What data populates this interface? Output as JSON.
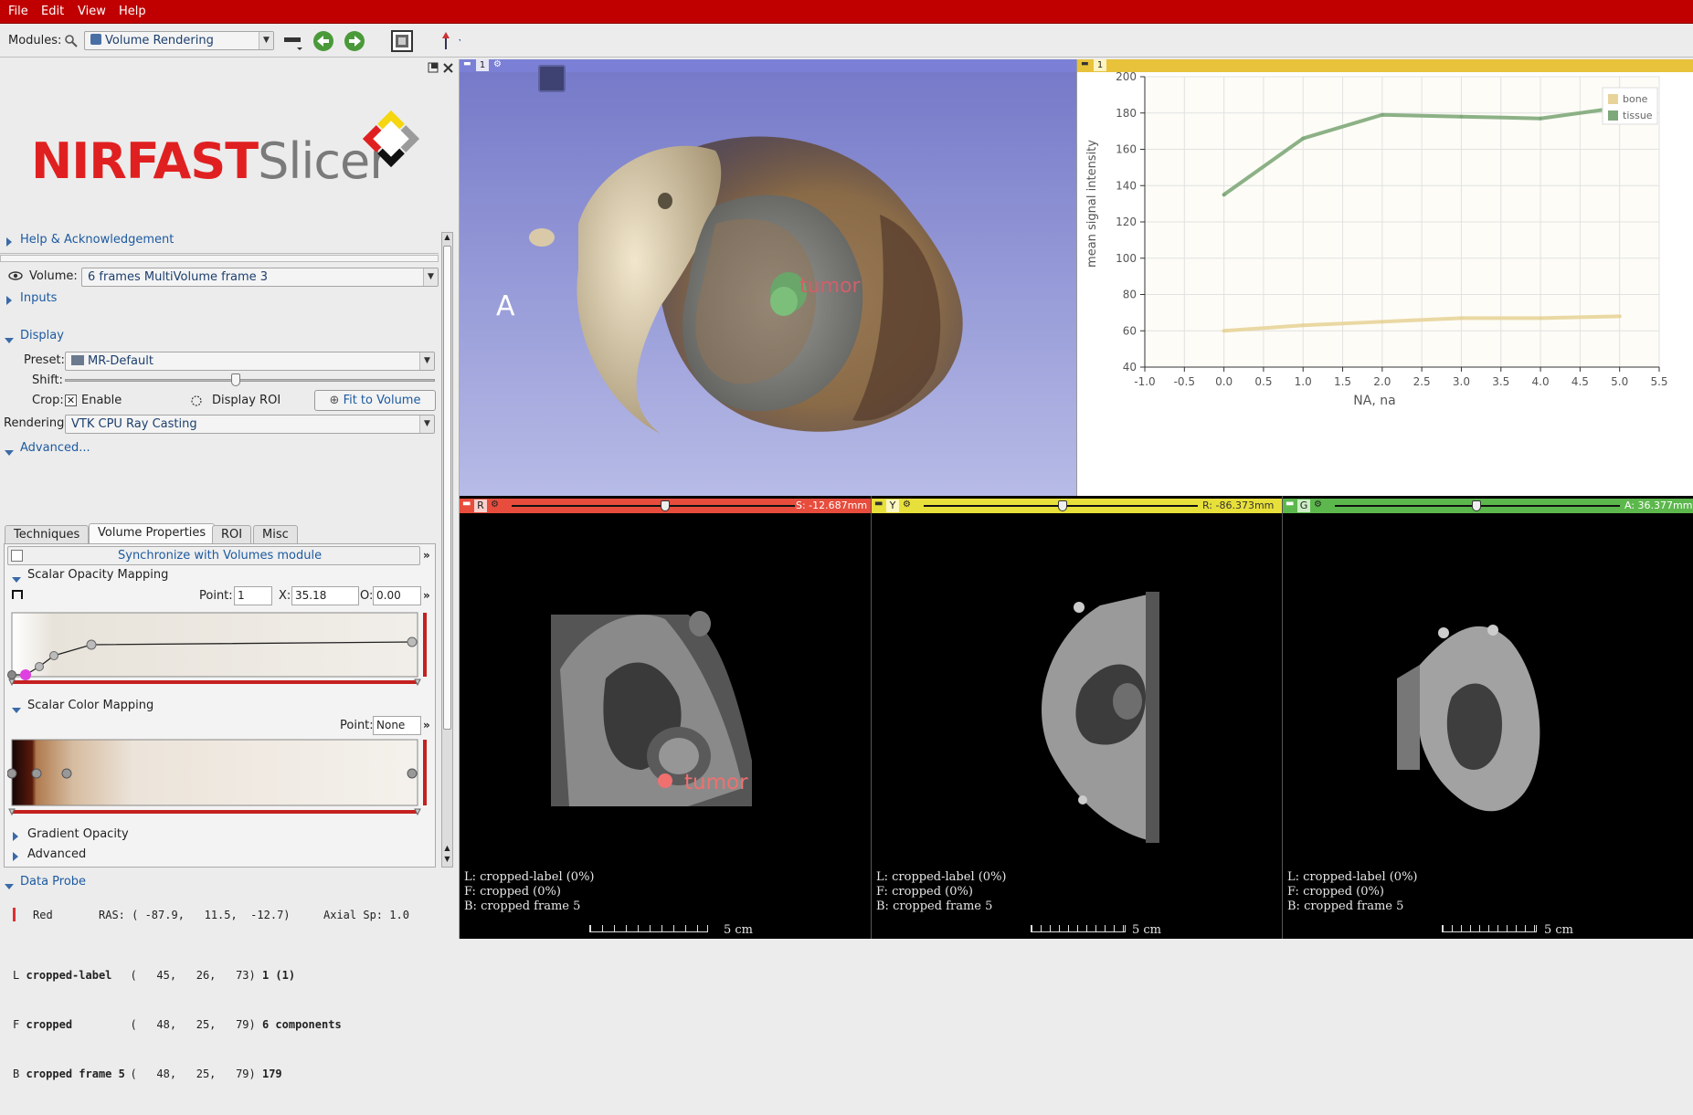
{
  "menu": {
    "items": [
      "File",
      "Edit",
      "View",
      "Help"
    ]
  },
  "toolbar": {
    "modules_label": "Modules:",
    "module_selected": "Volume Rendering"
  },
  "logo": {
    "text_part1": "NIRFAST",
    "text_part2": "Slicer"
  },
  "left": {
    "help_section": "Help & Acknowledgement",
    "volume_label": "Volume:",
    "volume_value": "6 frames MultiVolume frame 3",
    "inputs_section": "Inputs",
    "display_section": "Display",
    "preset_label": "Preset:",
    "preset_value": "MR-Default",
    "shift_label": "Shift:",
    "crop_label": "Crop:",
    "enable_label": "Enable",
    "display_roi_label": "Display ROI",
    "fit_button": "Fit to Volume",
    "rendering_label": "Rendering:",
    "rendering_value": "VTK CPU Ray Casting",
    "advanced_section": "Advanced...",
    "tabs": [
      "Techniques",
      "Volume Properties",
      "ROI",
      "Misc"
    ],
    "sync_button": "Synchronize with Volumes module",
    "scalar_opacity_title": "Scalar Opacity Mapping",
    "point_label": "Point:",
    "point_value": "1",
    "x_label": "X:",
    "x_value": "35.18",
    "o_label": "O:",
    "o_value": "0.00",
    "scalar_color_title": "Scalar Color Mapping",
    "color_point_value": "None",
    "gradient_opacity_title": "Gradient Opacity",
    "advanced_sub_title": "Advanced",
    "data_probe_section": "Data Probe",
    "probe_view": "Red",
    "probe_ras": "RAS: ( -87.9,   11.5,  -12.7)",
    "probe_sp": "Axial Sp: 1.0",
    "probe_rows": [
      {
        "layer": "L",
        "name": "cropped-label",
        "ijk": "(   45,   26,   73)",
        "value": "1 (1)"
      },
      {
        "layer": "F",
        "name": "cropped",
        "ijk": "(   48,   25,   79)",
        "value": "6 components"
      },
      {
        "layer": "B",
        "name": "cropped frame 5",
        "ijk": "(   48,   25,   79)",
        "value": "179"
      }
    ]
  },
  "view3d": {
    "number": "1",
    "orientation": "A",
    "tumor_label": "tumor"
  },
  "chartview": {
    "number": "1"
  },
  "chart_data": {
    "type": "line",
    "title": "",
    "xlabel": "NA, na",
    "ylabel": "mean signal intensity",
    "xlim": [
      -1.0,
      5.5
    ],
    "ylim": [
      40,
      200
    ],
    "xticks": [
      "-1.0",
      "-0.5",
      "0.0",
      "0.5",
      "1.0",
      "1.5",
      "2.0",
      "2.5",
      "3.0",
      "3.5",
      "4.0",
      "4.5",
      "5.0",
      "5.5"
    ],
    "yticks": [
      "40",
      "60",
      "80",
      "100",
      "120",
      "140",
      "160",
      "180",
      "200"
    ],
    "grid": true,
    "legend_position": "top-right",
    "x": [
      0,
      1,
      2,
      3,
      4,
      5
    ],
    "series": [
      {
        "name": "bone",
        "color": "#e8d49a",
        "values": [
          60,
          63,
          65,
          67,
          67,
          68
        ]
      },
      {
        "name": "tissue",
        "color": "#7fa87a",
        "values": [
          135,
          166,
          179,
          178,
          177,
          183
        ]
      }
    ]
  },
  "slices": [
    {
      "letter": "R",
      "color": "#e74c3c",
      "offset": "S: -12.687mm",
      "ann_l": "L: cropped-label (0%)",
      "ann_f": "F: cropped (0%)",
      "ann_b": "B: cropped frame 5",
      "scale": "5 cm",
      "tumor_label": "tumor"
    },
    {
      "letter": "Y",
      "color": "#e8e03a",
      "offset": "R: -86.373mm",
      "ann_l": "L: cropped-label (0%)",
      "ann_f": "F: cropped (0%)",
      "ann_b": "B: cropped frame 5",
      "scale": "5 cm"
    },
    {
      "letter": "G",
      "color": "#5cb84c",
      "offset": "A: 36.377mm",
      "ann_l": "L: cropped-label (0%)",
      "ann_f": "F: cropped (0%)",
      "ann_b": "B: cropped frame 5",
      "scale": "5 cm"
    }
  ],
  "colors": {
    "menubar": "#c00000",
    "view3d_bg_top": "#7478c8",
    "view3d_bg_bottom": "#b7bbe6",
    "chart_bar": "#e8c23a",
    "chart_bg": "#fdfcf6"
  }
}
